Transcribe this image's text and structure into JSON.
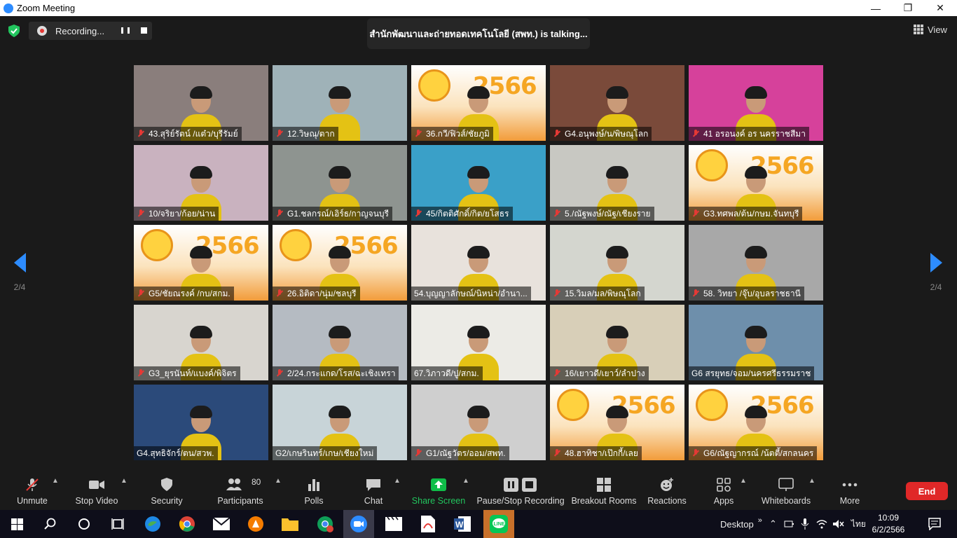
{
  "window": {
    "title": "Zoom Meeting",
    "controls": [
      "minimize",
      "maximize",
      "close"
    ]
  },
  "meeting": {
    "recording_label": "Recording...",
    "talking_text": "สำนักพัฒนาและถ่ายทอดเทคโนโลยี (สพท.) is  talking...",
    "view_label": "View",
    "page_left": "2/4",
    "page_right": "2/4"
  },
  "participants": [
    {
      "name": "43.สุริย์รัตน์ /แต๋ว/บุรีรัมย์",
      "bg": "#8a7e7c",
      "muted": true
    },
    {
      "name": "12.วิษณุ/ตาก",
      "bg": "#9fb2b8",
      "muted": true
    },
    {
      "name": "36.กวี/ฟิวส์/ชัยภูมิ",
      "bg": "#f7d9a8",
      "muted": true,
      "banner": "2566"
    },
    {
      "name": "G4.อนุพงษ์/น/พิษณุโลก",
      "bg": "#7a4a3a",
      "muted": true
    },
    {
      "name": "41 อรอนงค์ อร นครราชสีมา",
      "bg": "#d6419b",
      "muted": true
    },
    {
      "name": "10/จริยา/ก้อย/น่าน",
      "bg": "#c9b2bf",
      "muted": true
    },
    {
      "name": "G1.ชลกรณ์/เอิร์ธ/กาญจนบุรี",
      "bg": "#8e9490",
      "muted": true
    },
    {
      "name": "45/กิตติศักดิ์/กิต/ยโสธร",
      "bg": "#3aa0c8",
      "muted": true
    },
    {
      "name": "5./ณัฐพงษ์/ณัฐ/เชียงราย",
      "bg": "#c8c8c2",
      "muted": true
    },
    {
      "name": "G3.ทศพล/ต้น/กษม.จันทบุรี",
      "bg": "#f7d9a8",
      "muted": true,
      "banner": "2566"
    },
    {
      "name": "G5/ชัยณรงค์ /กบ/สกม.",
      "bg": "#f7d9a8",
      "muted": true,
      "banner": "2566"
    },
    {
      "name": "26.อิติดา/นุ่ม/ชลบุรี",
      "bg": "#f7d9a8",
      "muted": true,
      "banner": "2566"
    },
    {
      "name": "54.บุญญาลักษณ์/นิหน่า/อำนา...",
      "bg": "#e8e2dc",
      "muted": false
    },
    {
      "name": "15.วิมล/มล/พิษณุโลก",
      "bg": "#d4d6cf",
      "muted": true
    },
    {
      "name": "58. วิทยา /จุ๊บ/อุบลราชธานี",
      "bg": "#a8a8a8",
      "muted": true
    },
    {
      "name": "G3_ยุรนันท์/แบงค์/พิจิตร",
      "bg": "#d8d5cf",
      "muted": true
    },
    {
      "name": "2/24.กระแกด/โรส/ฉะเชิงเทรา",
      "bg": "#b5bbc2",
      "muted": true
    },
    {
      "name": "67.วิภาวดี/ปู/สกม.",
      "bg": "#ecebe6",
      "muted": false
    },
    {
      "name": "16/เยาวดี/เยาว์/ลำปาง",
      "bg": "#d8cfb8",
      "muted": true
    },
    {
      "name": "G6 สรยุทธ/จอม/นครศรีธรรมราช",
      "bg": "#6e8fab",
      "muted": false
    },
    {
      "name": "G4.สุทธิจักร์/ตน/สวพ.",
      "bg": "#2b4a7a",
      "muted": false
    },
    {
      "name": "G2/เกษรินทร์/เกษ/เชียงใหม่",
      "bg": "#c8d4d8",
      "muted": false
    },
    {
      "name": "G1/ณัฐวัตร/ออม/สพท.",
      "bg": "#cfcfcf",
      "muted": true
    },
    {
      "name": "48.ฮาทิชา/เป๊กกี้/เลย",
      "bg": "#f7d9a8",
      "muted": true,
      "banner": "2566"
    },
    {
      "name": "G6/ณัฐญากรณ์ /น้ตตี้/สกลนคร",
      "bg": "#f7d9a8",
      "muted": true,
      "banner": "2566"
    }
  ],
  "toolbar": {
    "unmute": "Unmute",
    "stop_video": "Stop Video",
    "security": "Security",
    "participants": "Participants",
    "participants_count": "80",
    "polls": "Polls",
    "chat": "Chat",
    "share_screen": "Share Screen",
    "pause_stop_recording": "Pause/Stop Recording",
    "breakout_rooms": "Breakout Rooms",
    "reactions": "Reactions",
    "apps": "Apps",
    "whiteboards": "Whiteboards",
    "more": "More",
    "end": "End"
  },
  "taskbar": {
    "desktop_label": "Desktop",
    "language": "ไทย",
    "time": "10:09",
    "date": "6/2/2566",
    "apps": [
      "start",
      "search",
      "cortana",
      "task-view",
      "edge",
      "chrome",
      "mail",
      "avast",
      "file-explorer",
      "chrome-profile",
      "zoom",
      "media",
      "acrobat",
      "word",
      "line"
    ]
  },
  "colors": {
    "accent_green": "#22c55e",
    "end_red": "#e02828",
    "zoom_blue": "#2D8CFF",
    "share_green": "#0fbd48"
  }
}
